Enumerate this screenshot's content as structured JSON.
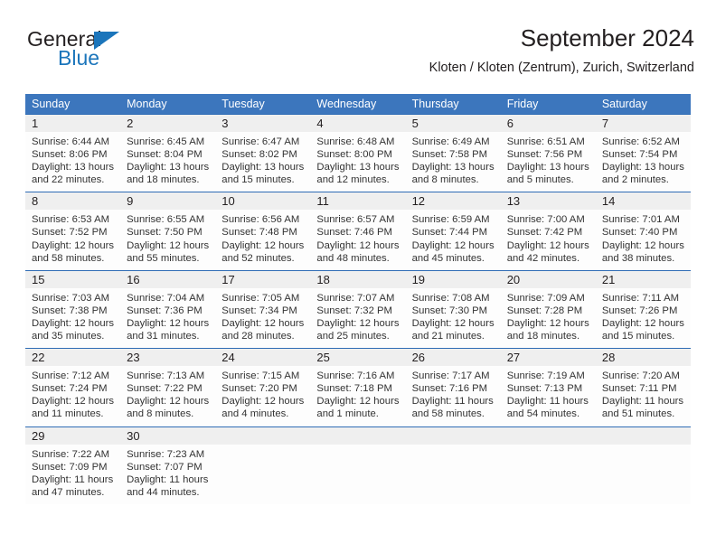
{
  "brand": {
    "word_one": "General",
    "word_two": "Blue",
    "triangle_color": "#1b75bb"
  },
  "header": {
    "title": "September 2024",
    "subtitle": "Kloten / Kloten (Zentrum), Zurich, Switzerland"
  },
  "theme": {
    "header_blue": "#3c76bd",
    "row_divider_blue": "#2f6cb5",
    "daynum_band": "#efefef",
    "text": "#333333"
  },
  "calendar": {
    "weekday_headers": [
      "Sunday",
      "Monday",
      "Tuesday",
      "Wednesday",
      "Thursday",
      "Friday",
      "Saturday"
    ],
    "weeks": [
      [
        {
          "day": "1",
          "sunrise": "Sunrise: 6:44 AM",
          "sunset": "Sunset: 8:06 PM",
          "daylight_1": "Daylight: 13 hours",
          "daylight_2": "and 22 minutes."
        },
        {
          "day": "2",
          "sunrise": "Sunrise: 6:45 AM",
          "sunset": "Sunset: 8:04 PM",
          "daylight_1": "Daylight: 13 hours",
          "daylight_2": "and 18 minutes."
        },
        {
          "day": "3",
          "sunrise": "Sunrise: 6:47 AM",
          "sunset": "Sunset: 8:02 PM",
          "daylight_1": "Daylight: 13 hours",
          "daylight_2": "and 15 minutes."
        },
        {
          "day": "4",
          "sunrise": "Sunrise: 6:48 AM",
          "sunset": "Sunset: 8:00 PM",
          "daylight_1": "Daylight: 13 hours",
          "daylight_2": "and 12 minutes."
        },
        {
          "day": "5",
          "sunrise": "Sunrise: 6:49 AM",
          "sunset": "Sunset: 7:58 PM",
          "daylight_1": "Daylight: 13 hours",
          "daylight_2": "and 8 minutes."
        },
        {
          "day": "6",
          "sunrise": "Sunrise: 6:51 AM",
          "sunset": "Sunset: 7:56 PM",
          "daylight_1": "Daylight: 13 hours",
          "daylight_2": "and 5 minutes."
        },
        {
          "day": "7",
          "sunrise": "Sunrise: 6:52 AM",
          "sunset": "Sunset: 7:54 PM",
          "daylight_1": "Daylight: 13 hours",
          "daylight_2": "and 2 minutes."
        }
      ],
      [
        {
          "day": "8",
          "sunrise": "Sunrise: 6:53 AM",
          "sunset": "Sunset: 7:52 PM",
          "daylight_1": "Daylight: 12 hours",
          "daylight_2": "and 58 minutes."
        },
        {
          "day": "9",
          "sunrise": "Sunrise: 6:55 AM",
          "sunset": "Sunset: 7:50 PM",
          "daylight_1": "Daylight: 12 hours",
          "daylight_2": "and 55 minutes."
        },
        {
          "day": "10",
          "sunrise": "Sunrise: 6:56 AM",
          "sunset": "Sunset: 7:48 PM",
          "daylight_1": "Daylight: 12 hours",
          "daylight_2": "and 52 minutes."
        },
        {
          "day": "11",
          "sunrise": "Sunrise: 6:57 AM",
          "sunset": "Sunset: 7:46 PM",
          "daylight_1": "Daylight: 12 hours",
          "daylight_2": "and 48 minutes."
        },
        {
          "day": "12",
          "sunrise": "Sunrise: 6:59 AM",
          "sunset": "Sunset: 7:44 PM",
          "daylight_1": "Daylight: 12 hours",
          "daylight_2": "and 45 minutes."
        },
        {
          "day": "13",
          "sunrise": "Sunrise: 7:00 AM",
          "sunset": "Sunset: 7:42 PM",
          "daylight_1": "Daylight: 12 hours",
          "daylight_2": "and 42 minutes."
        },
        {
          "day": "14",
          "sunrise": "Sunrise: 7:01 AM",
          "sunset": "Sunset: 7:40 PM",
          "daylight_1": "Daylight: 12 hours",
          "daylight_2": "and 38 minutes."
        }
      ],
      [
        {
          "day": "15",
          "sunrise": "Sunrise: 7:03 AM",
          "sunset": "Sunset: 7:38 PM",
          "daylight_1": "Daylight: 12 hours",
          "daylight_2": "and 35 minutes."
        },
        {
          "day": "16",
          "sunrise": "Sunrise: 7:04 AM",
          "sunset": "Sunset: 7:36 PM",
          "daylight_1": "Daylight: 12 hours",
          "daylight_2": "and 31 minutes."
        },
        {
          "day": "17",
          "sunrise": "Sunrise: 7:05 AM",
          "sunset": "Sunset: 7:34 PM",
          "daylight_1": "Daylight: 12 hours",
          "daylight_2": "and 28 minutes."
        },
        {
          "day": "18",
          "sunrise": "Sunrise: 7:07 AM",
          "sunset": "Sunset: 7:32 PM",
          "daylight_1": "Daylight: 12 hours",
          "daylight_2": "and 25 minutes."
        },
        {
          "day": "19",
          "sunrise": "Sunrise: 7:08 AM",
          "sunset": "Sunset: 7:30 PM",
          "daylight_1": "Daylight: 12 hours",
          "daylight_2": "and 21 minutes."
        },
        {
          "day": "20",
          "sunrise": "Sunrise: 7:09 AM",
          "sunset": "Sunset: 7:28 PM",
          "daylight_1": "Daylight: 12 hours",
          "daylight_2": "and 18 minutes."
        },
        {
          "day": "21",
          "sunrise": "Sunrise: 7:11 AM",
          "sunset": "Sunset: 7:26 PM",
          "daylight_1": "Daylight: 12 hours",
          "daylight_2": "and 15 minutes."
        }
      ],
      [
        {
          "day": "22",
          "sunrise": "Sunrise: 7:12 AM",
          "sunset": "Sunset: 7:24 PM",
          "daylight_1": "Daylight: 12 hours",
          "daylight_2": "and 11 minutes."
        },
        {
          "day": "23",
          "sunrise": "Sunrise: 7:13 AM",
          "sunset": "Sunset: 7:22 PM",
          "daylight_1": "Daylight: 12 hours",
          "daylight_2": "and 8 minutes."
        },
        {
          "day": "24",
          "sunrise": "Sunrise: 7:15 AM",
          "sunset": "Sunset: 7:20 PM",
          "daylight_1": "Daylight: 12 hours",
          "daylight_2": "and 4 minutes."
        },
        {
          "day": "25",
          "sunrise": "Sunrise: 7:16 AM",
          "sunset": "Sunset: 7:18 PM",
          "daylight_1": "Daylight: 12 hours",
          "daylight_2": "and 1 minute."
        },
        {
          "day": "26",
          "sunrise": "Sunrise: 7:17 AM",
          "sunset": "Sunset: 7:16 PM",
          "daylight_1": "Daylight: 11 hours",
          "daylight_2": "and 58 minutes."
        },
        {
          "day": "27",
          "sunrise": "Sunrise: 7:19 AM",
          "sunset": "Sunset: 7:13 PM",
          "daylight_1": "Daylight: 11 hours",
          "daylight_2": "and 54 minutes."
        },
        {
          "day": "28",
          "sunrise": "Sunrise: 7:20 AM",
          "sunset": "Sunset: 7:11 PM",
          "daylight_1": "Daylight: 11 hours",
          "daylight_2": "and 51 minutes."
        }
      ],
      [
        {
          "day": "29",
          "sunrise": "Sunrise: 7:22 AM",
          "sunset": "Sunset: 7:09 PM",
          "daylight_1": "Daylight: 11 hours",
          "daylight_2": "and 47 minutes."
        },
        {
          "day": "30",
          "sunrise": "Sunrise: 7:23 AM",
          "sunset": "Sunset: 7:07 PM",
          "daylight_1": "Daylight: 11 hours",
          "daylight_2": "and 44 minutes."
        },
        {
          "day": "",
          "sunrise": "",
          "sunset": "",
          "daylight_1": "",
          "daylight_2": ""
        },
        {
          "day": "",
          "sunrise": "",
          "sunset": "",
          "daylight_1": "",
          "daylight_2": ""
        },
        {
          "day": "",
          "sunrise": "",
          "sunset": "",
          "daylight_1": "",
          "daylight_2": ""
        },
        {
          "day": "",
          "sunrise": "",
          "sunset": "",
          "daylight_1": "",
          "daylight_2": ""
        },
        {
          "day": "",
          "sunrise": "",
          "sunset": "",
          "daylight_1": "",
          "daylight_2": ""
        }
      ]
    ]
  }
}
